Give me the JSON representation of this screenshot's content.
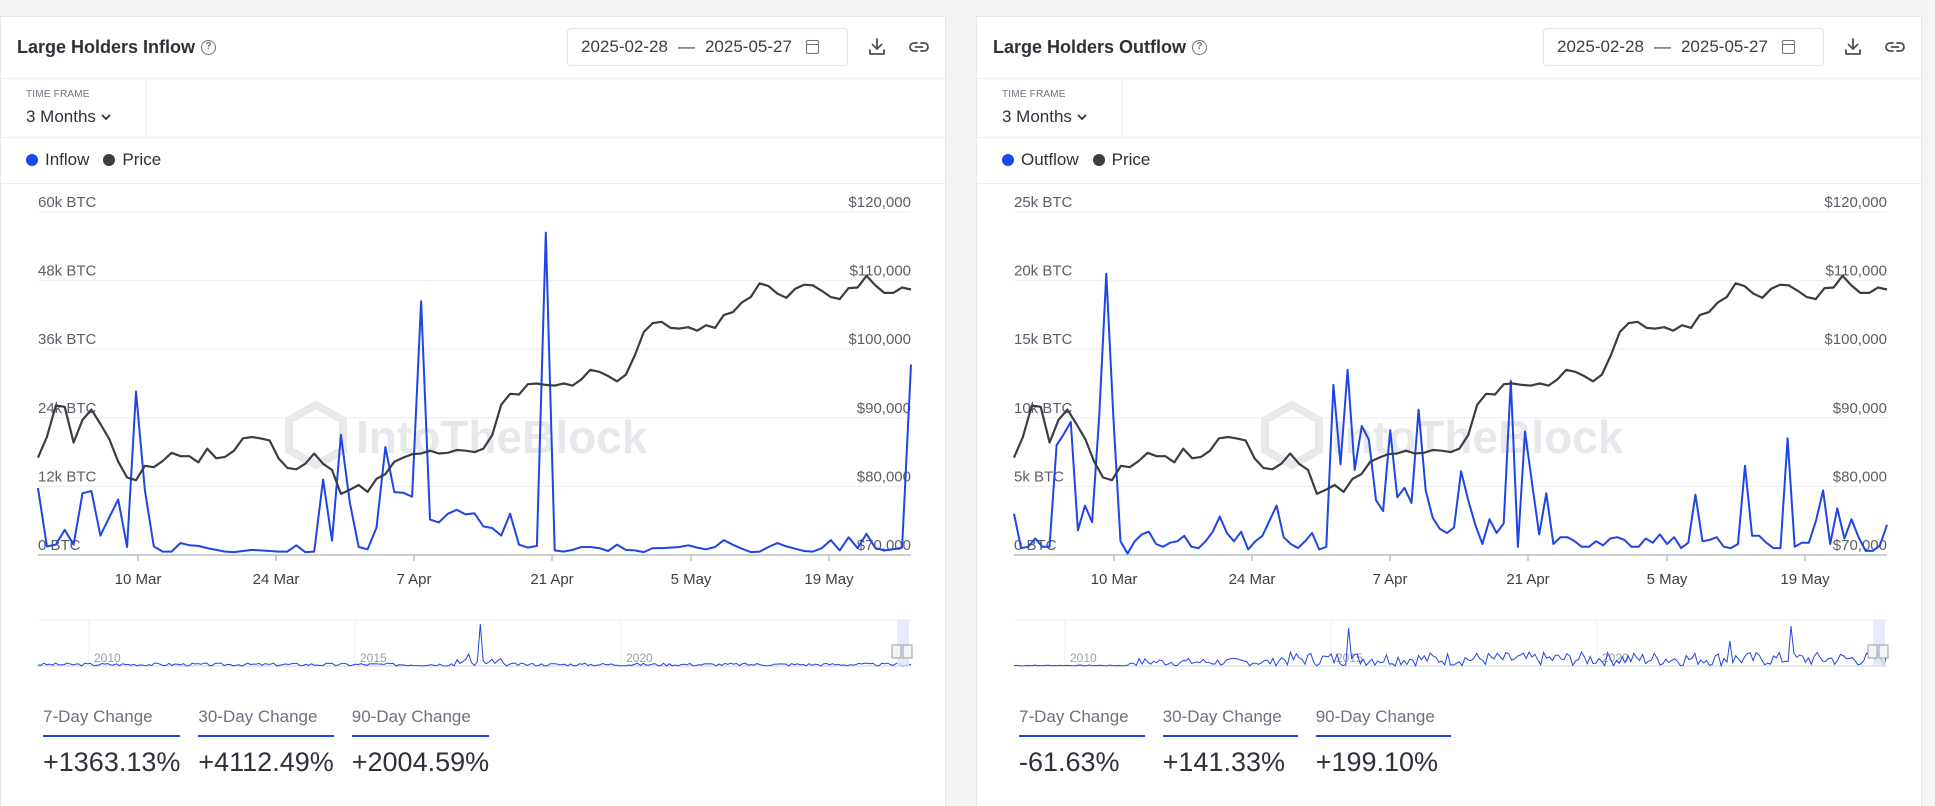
{
  "panels": [
    {
      "title": "Large Holders Inflow",
      "date_start": "2025-02-28",
      "date_sep": "—",
      "date_end": "2025-05-27",
      "timeframe_label": "TIME FRAME",
      "timeframe_value": "3 Months",
      "legend": [
        {
          "label": "Inflow",
          "color": "#1f45e6"
        },
        {
          "label": "Price",
          "color": "#3a3d42"
        }
      ],
      "changes": [
        {
          "label": "7-Day Change",
          "value": "+1363.13%"
        },
        {
          "label": "30-Day Change",
          "value": "+4112.49%"
        },
        {
          "label": "90-Day Change",
          "value": "+2004.59%"
        }
      ]
    },
    {
      "title": "Large Holders Outflow",
      "date_start": "2025-02-28",
      "date_sep": "—",
      "date_end": "2025-05-27",
      "timeframe_label": "TIME FRAME",
      "timeframe_value": "3 Months",
      "legend": [
        {
          "label": "Outflow",
          "color": "#1f45e6"
        },
        {
          "label": "Price",
          "color": "#3a3d42"
        }
      ],
      "changes": [
        {
          "label": "7-Day Change",
          "value": "-61.63%"
        },
        {
          "label": "30-Day Change",
          "value": "+141.33%"
        },
        {
          "label": "90-Day Change",
          "value": "+199.10%"
        }
      ]
    }
  ],
  "watermark": "IntoTheBlock",
  "chart_data": [
    {
      "type": "line",
      "x_tick_labels": [
        "10 Mar",
        "24 Mar",
        "7 Apr",
        "21 Apr",
        "5 May",
        "19 May"
      ],
      "y_left_ticks": [
        "0 BTC",
        "12k BTC",
        "24k BTC",
        "36k BTC",
        "48k BTC",
        "60k BTC"
      ],
      "y_left_range": [
        0,
        60000
      ],
      "y_right_ticks": [
        "$70,000",
        "$80,000",
        "$90,000",
        "$100,000",
        "$110,000",
        "$120,000"
      ],
      "y_right_range": [
        70000,
        120000
      ],
      "navigator_labels": [
        "2010",
        "2015",
        "2020"
      ],
      "series": [
        {
          "name": "Inflow",
          "axis": "left",
          "values": [
            11700,
            1500,
            1800,
            4400,
            1800,
            10800,
            11200,
            3400,
            6600,
            9700,
            1400,
            28600,
            11300,
            1500,
            600,
            600,
            2100,
            1700,
            1600,
            1200,
            900,
            600,
            500,
            700,
            900,
            800,
            700,
            600,
            600,
            1700,
            500,
            600,
            13200,
            2500,
            21000,
            9200,
            1400,
            1000,
            4800,
            18900,
            11000,
            10900,
            10200,
            44400,
            6200,
            5700,
            7200,
            7900,
            7100,
            7300,
            5000,
            4700,
            3400,
            7200,
            1800,
            1300,
            1600,
            56400,
            800,
            600,
            900,
            1400,
            1400,
            1200,
            700,
            1800,
            900,
            800,
            500,
            1200,
            1200,
            1300,
            1400,
            1700,
            1300,
            1000,
            1400,
            2600,
            1800,
            1100,
            500,
            600,
            1400,
            2100,
            1500,
            1100,
            700,
            600,
            1200,
            2600,
            800,
            3100,
            1200,
            3700,
            1200,
            800,
            1000,
            1300,
            33300
          ]
        },
        {
          "name": "Price",
          "axis": "right",
          "values": [
            84200,
            87200,
            91800,
            91600,
            86400,
            89700,
            91200,
            89100,
            86900,
            83600,
            81300,
            80900,
            83000,
            82800,
            83700,
            84900,
            84400,
            84400,
            83500,
            85500,
            84100,
            84300,
            85200,
            87000,
            87200,
            87000,
            86700,
            84100,
            82700,
            82500,
            83300,
            84800,
            83300,
            82400,
            78900,
            79500,
            80200,
            79200,
            81100,
            81800,
            83600,
            84200,
            84700,
            84800,
            85200,
            84800,
            84900,
            85300,
            85200,
            85000,
            85500,
            87500,
            91900,
            93500,
            93400,
            94900,
            95000,
            94800,
            94700,
            95000,
            94700,
            95600,
            97000,
            96700,
            96100,
            95300,
            96300,
            99100,
            102500,
            103800,
            104000,
            103100,
            103000,
            103200,
            102700,
            103500,
            103100,
            105000,
            105400,
            106800,
            107600,
            109600,
            109200,
            108100,
            107500,
            108800,
            109400,
            109300,
            108500,
            107600,
            107300,
            108900,
            109000,
            110700,
            109300,
            108200,
            108200,
            109000,
            108700
          ]
        }
      ]
    },
    {
      "type": "line",
      "x_tick_labels": [
        "10 Mar",
        "24 Mar",
        "7 Apr",
        "21 Apr",
        "5 May",
        "19 May"
      ],
      "y_left_ticks": [
        "0 BTC",
        "5k BTC",
        "10k BTC",
        "15k BTC",
        "20k BTC",
        "25k BTC"
      ],
      "y_left_range": [
        0,
        25000
      ],
      "y_right_ticks": [
        "$70,000",
        "$80,000",
        "$90,000",
        "$100,000",
        "$110,000",
        "$120,000"
      ],
      "y_right_range": [
        70000,
        120000
      ],
      "navigator_labels": [
        "2010",
        "2015",
        "2020"
      ],
      "series": [
        {
          "name": "Outflow",
          "axis": "left",
          "values": [
            3000,
            500,
            600,
            1200,
            600,
            600,
            8000,
            8800,
            9700,
            1800,
            3600,
            2400,
            10100,
            20500,
            10000,
            1000,
            100,
            1000,
            1500,
            1700,
            800,
            600,
            900,
            1000,
            1400,
            600,
            500,
            1000,
            1700,
            2800,
            1600,
            1000,
            1700,
            400,
            1000,
            1400,
            2500,
            3600,
            1300,
            800,
            500,
            1000,
            1600,
            400,
            600,
            12400,
            6600,
            13500,
            6200,
            9400,
            8400,
            4000,
            3200,
            9100,
            4200,
            4900,
            3800,
            10600,
            4700,
            2700,
            1900,
            1600,
            2000,
            6100,
            4000,
            2200,
            800,
            2600,
            1600,
            2300,
            12700,
            600,
            9000,
            5200,
            1500,
            4500,
            800,
            1300,
            1300,
            1000,
            600,
            600,
            1000,
            700,
            1200,
            1300,
            1100,
            600,
            600,
            1200,
            900,
            1500,
            800,
            1300,
            500,
            900,
            4400,
            1000,
            1100,
            1300,
            600,
            500,
            800,
            6500,
            1400,
            1400,
            900,
            500,
            500,
            8500,
            600,
            900,
            900,
            2500,
            4700,
            800,
            3400,
            1200,
            2600,
            1300,
            300,
            300,
            700,
            2200
          ]
        },
        {
          "name": "Price",
          "axis": "right",
          "values": [
            84200,
            87200,
            91800,
            91600,
            86400,
            89700,
            91200,
            89100,
            86900,
            83600,
            81300,
            80900,
            83000,
            82800,
            83700,
            84900,
            84400,
            84400,
            83500,
            85500,
            84100,
            84300,
            85200,
            87000,
            87200,
            87000,
            86700,
            84100,
            82700,
            82500,
            83300,
            84800,
            83300,
            82400,
            78900,
            79500,
            80200,
            79200,
            81100,
            81800,
            83600,
            84200,
            84700,
            84800,
            85200,
            84800,
            84900,
            85300,
            85200,
            85000,
            85500,
            87500,
            91900,
            93500,
            93400,
            94900,
            95000,
            94800,
            94700,
            95000,
            94700,
            95600,
            97000,
            96700,
            96100,
            95300,
            96300,
            99100,
            102500,
            103800,
            104000,
            103100,
            103000,
            103200,
            102700,
            103500,
            103100,
            105000,
            105400,
            106800,
            107600,
            109600,
            109200,
            108100,
            107500,
            108800,
            109400,
            109300,
            108500,
            107600,
            107300,
            108900,
            109000,
            110700,
            109300,
            108200,
            108200,
            109000,
            108700
          ]
        }
      ]
    }
  ]
}
